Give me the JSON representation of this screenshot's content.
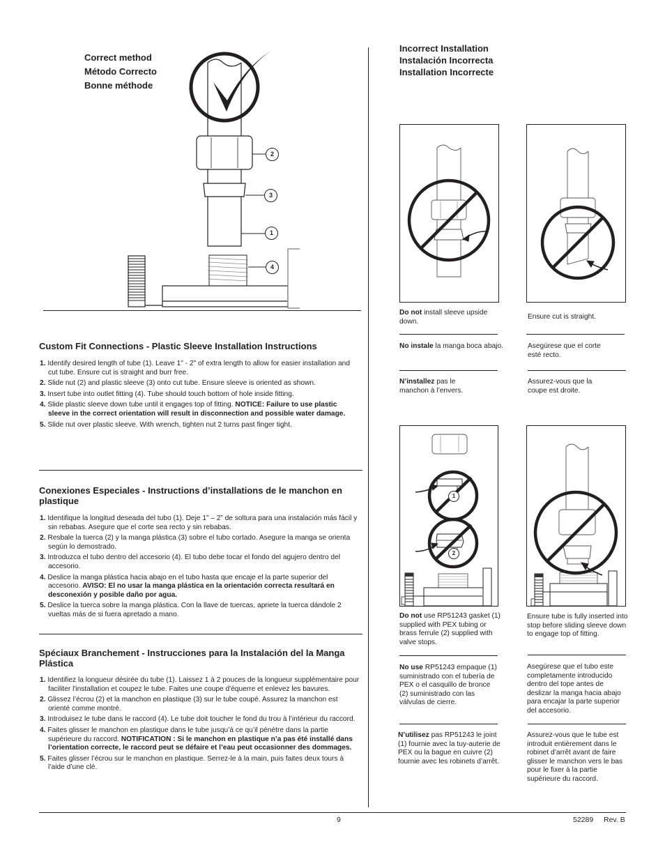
{
  "correct_method": {
    "titles": [
      "Correct method",
      "Método Correcto",
      "Bonne méthode"
    ],
    "callouts": [
      "2",
      "3",
      "1",
      "4"
    ]
  },
  "incorrect_installation": {
    "titles": [
      "Incorrect Installation",
      "Instalación Incorrecta",
      "Installation Incorrecte"
    ]
  },
  "sections": [
    {
      "heading": "Custom Fit Connections - Plastic Sleeve Installation Instructions",
      "steps": [
        {
          "num": "1.",
          "text": "Identify desired length of tube (1). Leave 1\" - 2\" of extra length to allow for easier installation and cut tube. Ensure cut is straight and burr free.",
          "bold": ""
        },
        {
          "num": "2.",
          "text": "Slide nut (2) and plastic sleeve (3) onto cut tube. Ensure sleeve is oriented as shown.",
          "bold": ""
        },
        {
          "num": "3.",
          "text": "Insert tube into outlet fitting (4). Tube should touch bottom of hole inside fitting.",
          "bold": ""
        },
        {
          "num": "4.",
          "text": "Slide plastic sleeve down tube until it engages top of fitting. ",
          "bold": "NOTICE: Failure to use plastic sleeve in the correct orientation will result in disconnection and possible water damage."
        },
        {
          "num": "5.",
          "text": "Slide nut over plastic sleeve. With wrench, tighten nut 2 turns past finger tight.",
          "bold": ""
        }
      ]
    },
    {
      "heading": "Conexiones Especiales - Instructions d’installations de le manchon en plastique",
      "steps": [
        {
          "num": "1.",
          "text": "Identifique la longitud deseada del tubo (1). Deje 1” – 2” de soltura para una instalación más fácil y sin rebabas. Asegure que el corte sea recto y sin rebabas.",
          "bold": ""
        },
        {
          "num": "2.",
          "text": "Resbale la tuerca (2) y la manga plástica (3) sobre el tubo cortado. Asegure la manga se orienta según lo demostrado.",
          "bold": ""
        },
        {
          "num": "3.",
          "text": "Introduzca el tubo dentro del accesorio (4). El tubo debe tocar el fondo del agujero dentro del accesorio.",
          "bold": ""
        },
        {
          "num": "4.",
          "text": "Deslice la manga plástica hacia abajo en el tubo hasta que encaje el la parte superior del accesorio. ",
          "bold": "AVISO: El no usar la manga plástica en la orientación correcta resultará en desconexión y posible daño por agua."
        },
        {
          "num": "5.",
          "text": "Deslice la tuerca sobre la manga plástica. Con la llave de tuercas, apriete la tuerca dándole 2 vueltas más de si fuera apretado a mano.",
          "bold": ""
        }
      ]
    },
    {
      "heading": "Spéciaux Branchement - Instrucciones para la Instalación del la Manga Plástica",
      "steps": [
        {
          "num": "1.",
          "text": "Identifiez la longueur désirée du tube (1). Laissez 1 à 2 pouces de la longueur supplémentaire pour faciliter l'installation et coupez le tube. Faites une coupe d'équerre et enlevez les bavures.",
          "bold": ""
        },
        {
          "num": "2.",
          "text": "Glissez l’écrou (2) et la manchon en plastique (3) sur le tube coupé. Assurez la manchon est orienté comme montré.",
          "bold": ""
        },
        {
          "num": "3.",
          "text": "Introduisez le tube dans le raccord (4). Le tube doit toucher le fond du trou à l’intérieur du raccord.",
          "bold": ""
        },
        {
          "num": "4.",
          "text": "Faites glisser le manchon en plastique dans le tube jusqu’à ce qu’il pénètre dans la partie supérieure du raccord. ",
          "bold": "NOTIFICATION : Si le manchon en plastique n’a pas été installé dans l’orientation correcte, le raccord peut se défaire et l’eau peut occasionner des dommages."
        },
        {
          "num": "5.",
          "text": "Faites glisser l’écrou sur le manchon en plastique. Serrez-le à la main, puis faites deux tours à l’aide d’une clé.",
          "bold": ""
        }
      ]
    }
  ],
  "captions": {
    "sleeve_upside_down": [
      {
        "bold": "Do not",
        "text": " install sleeve upside down."
      },
      {
        "bold": "No instale",
        "text": " la manga boca abajo."
      },
      {
        "bold": "N’installez",
        "text": " pas le manchon à l’envers."
      }
    ],
    "cut_straight": [
      {
        "bold": "",
        "text": "Ensure cut is straight."
      },
      {
        "bold": "",
        "text": "Asegúrese que el corte esté recto."
      },
      {
        "bold": "",
        "text": "Assurez-vous que la coupe est droite."
      }
    ],
    "gasket_ferrule": [
      {
        "bold": "Do not",
        "text": " use RP51243 gasket (1) supplied with PEX tubing or brass ferrule (2) supplied with valve stops."
      },
      {
        "bold": "No use",
        "text": " RP51243 empaque (1) suministrado con el tubería de PEX o el casquillo de bronce (2) suministrado con las válvulas de cierre."
      },
      {
        "bold": "N’utilisez",
        "text": " pas RP51243 le joint (1) fournie avec la tuy-auterie de PEX ou la bague en cuivre (2) fournie avec les robinets d’arrêt."
      }
    ],
    "tube_inserted": [
      {
        "bold": "",
        "text": "Ensure tube is fully inserted into stop before sliding sleeve down to engage top of fitting."
      },
      {
        "bold": "",
        "text": "Asegúrese que el tubo este completamente introducido dentro del tope antes de deslizar la manga hacia abajo para encajar la parte superior del accesorio."
      },
      {
        "bold": "",
        "text": "Assurez-vous que le tube est introduit entièrement dans le robinet d’arrêt avant de faire glisser le manchon vers le bas pour le fixer à la partie supérieure du raccord."
      }
    ],
    "panel_callouts": [
      "1",
      "2"
    ]
  },
  "footer": {
    "page_number": "9",
    "doc_number": "52289",
    "revision": "Rev. B"
  }
}
